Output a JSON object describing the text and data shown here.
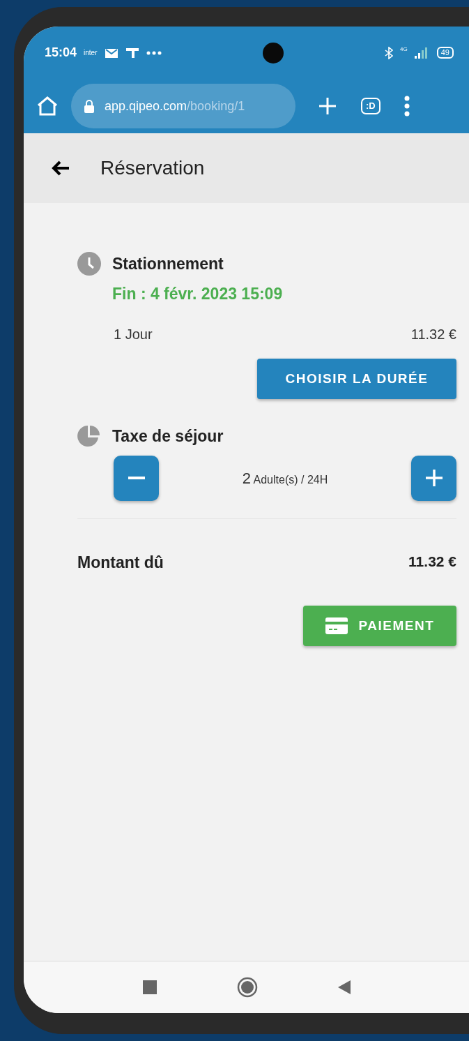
{
  "status_bar": {
    "time": "15:04",
    "carrier": "inter",
    "network": "4G",
    "battery": "49"
  },
  "browser": {
    "url_host": "app.qipeo.com",
    "url_path": "/booking/1",
    "tabs_button": ":D"
  },
  "app_bar": {
    "title": "Réservation"
  },
  "parking": {
    "title": "Stationnement",
    "end": "Fin : 4 févr. 2023 15:09",
    "duration": "1 Jour",
    "price": "11.32 €",
    "button": "CHOISIR LA DURÉE"
  },
  "tax": {
    "title": "Taxe de séjour",
    "count": "2",
    "unit": "Adulte(s) / 24H"
  },
  "total": {
    "label": "Montant dû",
    "value": "11.32 €",
    "button": "PAIEMENT"
  }
}
